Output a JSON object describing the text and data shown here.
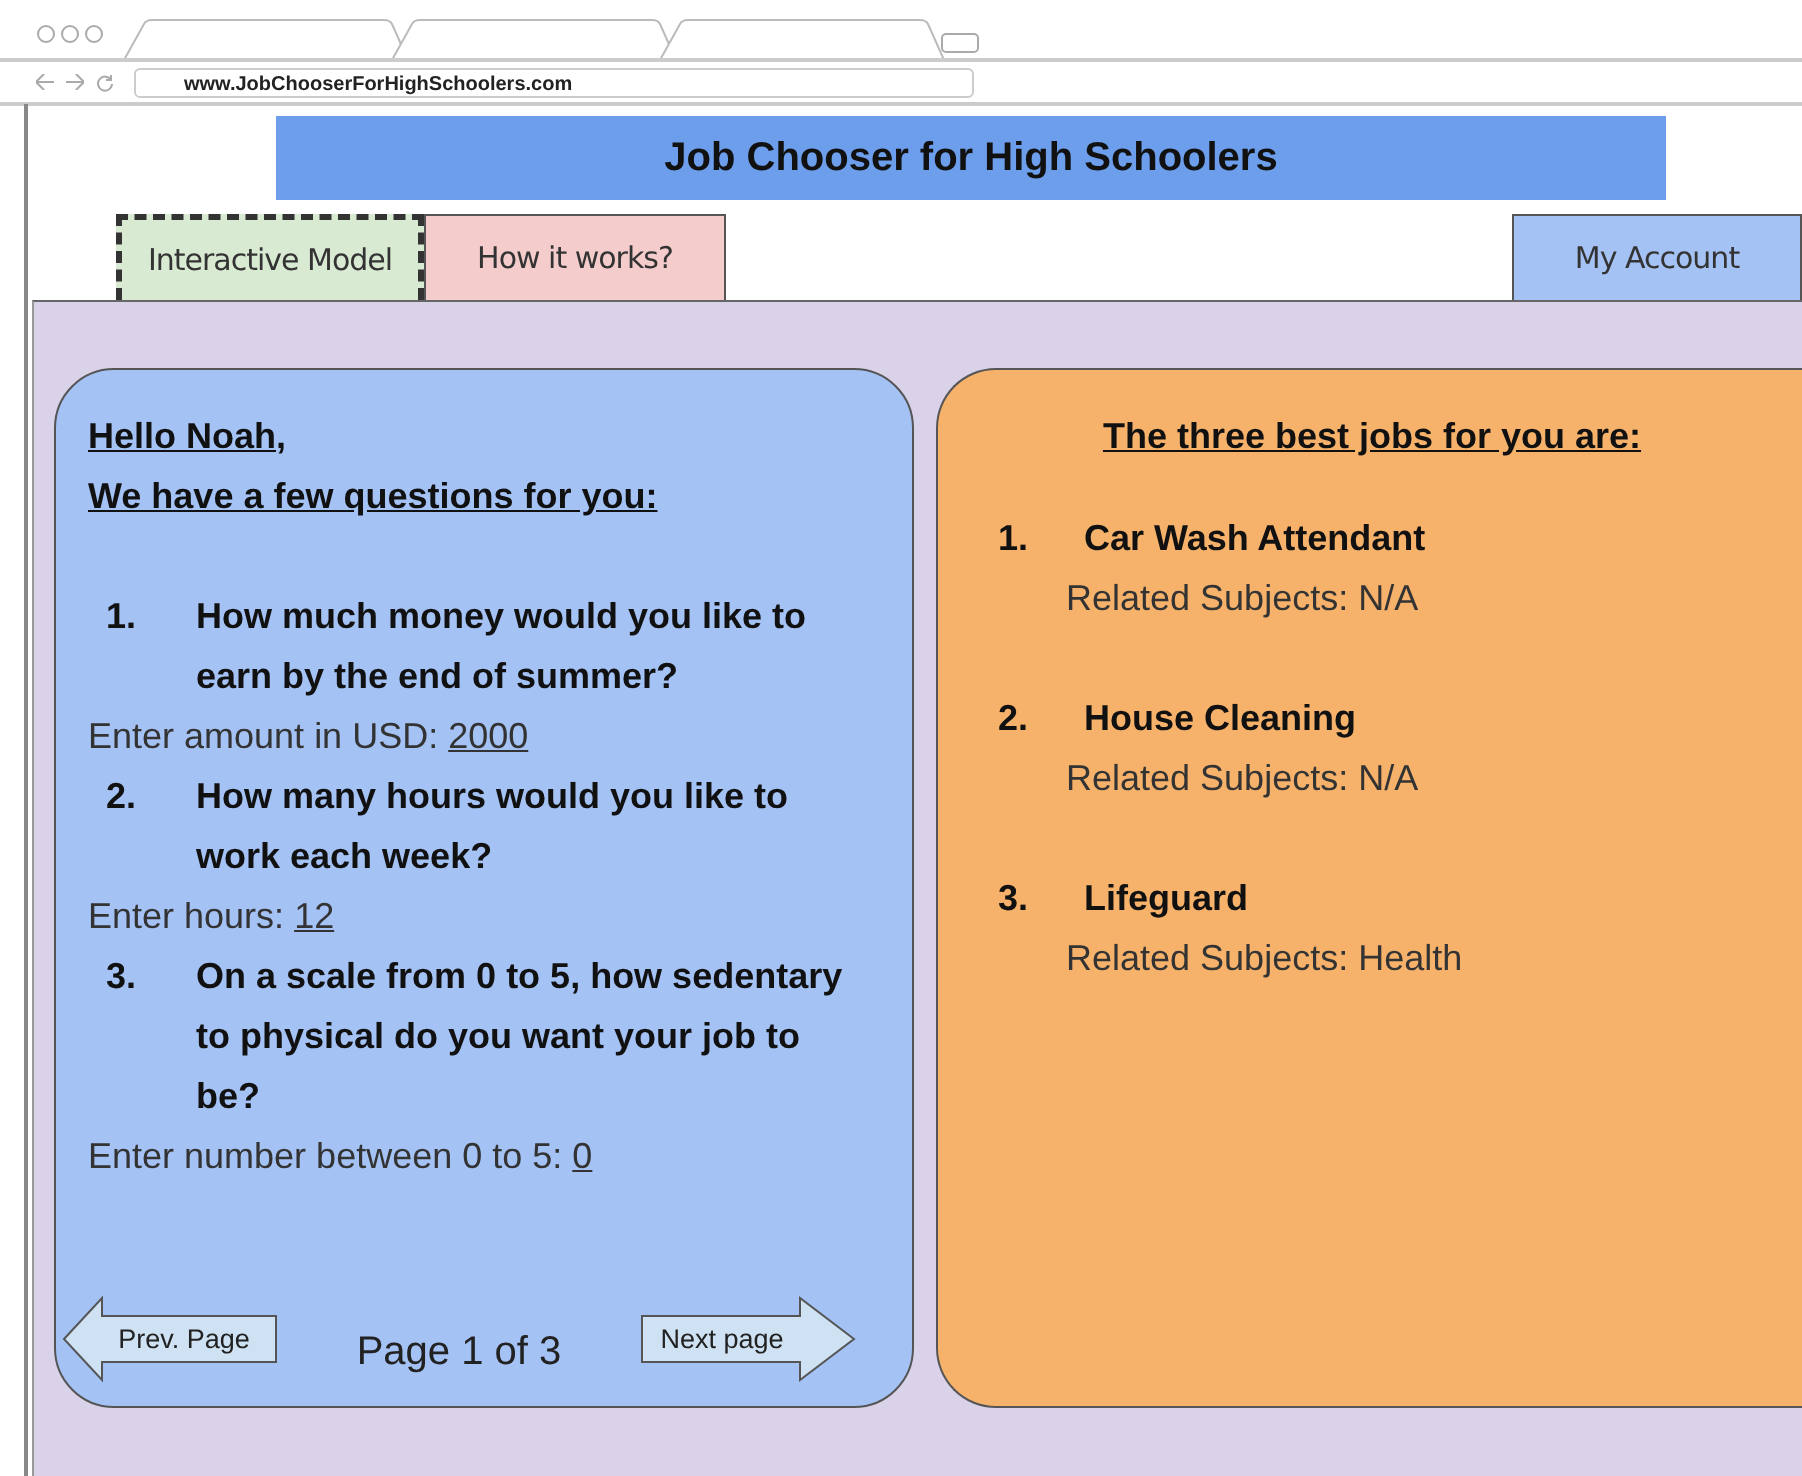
{
  "browser": {
    "url": "www.JobChooserForHighSchoolers.com"
  },
  "header": {
    "title": "Job Chooser for High Schoolers"
  },
  "tabs": [
    {
      "label": "Interactive Model",
      "selected": true,
      "color": "#d9ead3"
    },
    {
      "label": "How it works?",
      "selected": false,
      "color": "#f4cccc"
    }
  ],
  "account_button": {
    "label": "My Account"
  },
  "questionnaire": {
    "greeting": "Hello Noah,",
    "intro": "We have a few questions for you:",
    "questions": [
      {
        "number": "1.",
        "text": "How much money would you like to earn by the end of summer?",
        "prompt": "Enter amount in USD:",
        "answer": "2000"
      },
      {
        "number": "2.",
        "text": "How many hours would you like to work each week?",
        "prompt": "Enter hours:",
        "answer": "12"
      },
      {
        "number": "3.",
        "text": "On a scale from 0 to 5, how sedentary to physical do you want your job to be?",
        "prompt": "Enter number between 0 to 5:",
        "answer": "0"
      }
    ],
    "pager": {
      "previous": "Prev. Page",
      "status": "Page 1 of 3",
      "next": "Next page"
    }
  },
  "results": {
    "heading": "The three best jobs for you are:",
    "jobs": [
      {
        "number": "1.",
        "title": "Car Wash Attendant",
        "subjects": "Related Subjects: N/A"
      },
      {
        "number": "2.",
        "title": "House Cleaning",
        "subjects": "Related Subjects: N/A"
      },
      {
        "number": "3.",
        "title": "Lifeguard",
        "subjects": "Related Subjects: Health"
      }
    ]
  }
}
